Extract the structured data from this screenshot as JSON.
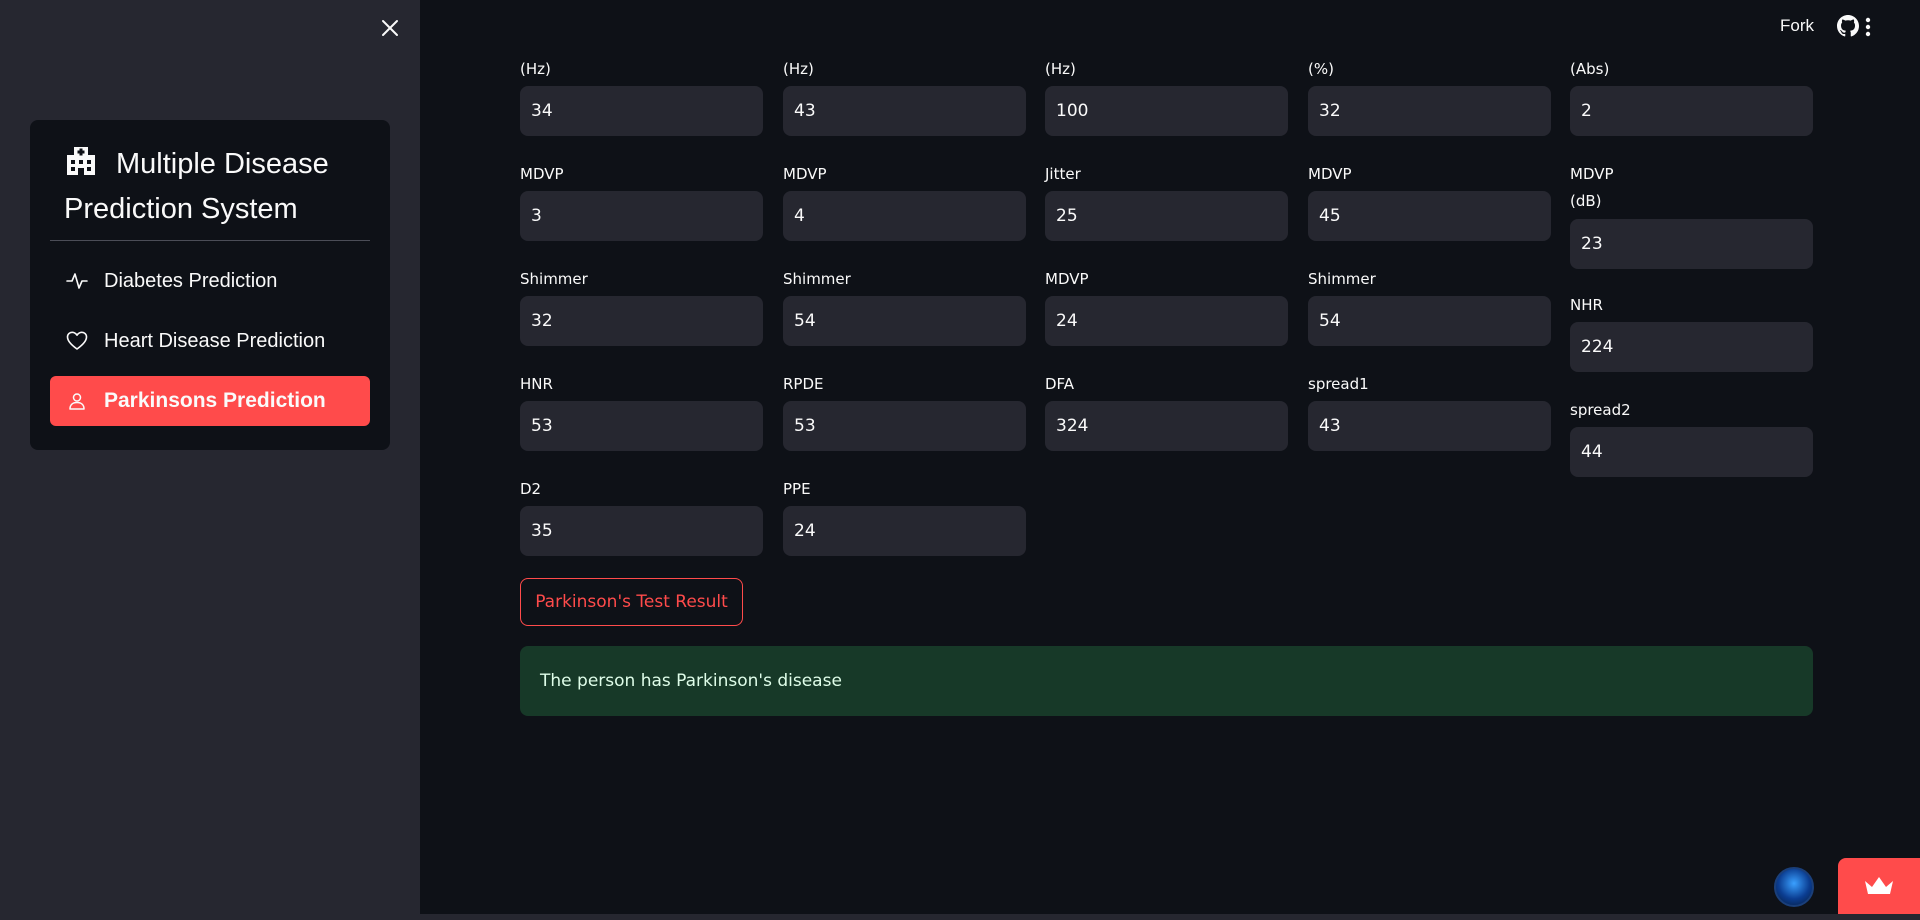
{
  "sidebar": {
    "title": "Multiple Disease Prediction System",
    "items": [
      {
        "label": "Diabetes Prediction",
        "icon": "activity-icon"
      },
      {
        "label": "Heart Disease Prediction",
        "icon": "heart-icon"
      },
      {
        "label": "Parkinsons Prediction",
        "icon": "person-icon"
      }
    ],
    "active_item": "Parkinsons Prediction",
    "accent_color": "#ff4b4b"
  },
  "topbar": {
    "fork_label": "Fork"
  },
  "form": {
    "fields": [
      {
        "label": "(Hz)",
        "value": "34"
      },
      {
        "label": "(Hz)",
        "value": "43"
      },
      {
        "label": "(Hz)",
        "value": "100"
      },
      {
        "label": "(%)",
        "value": "32"
      },
      {
        "label": "(Abs)",
        "value": "2"
      },
      {
        "label": "MDVP",
        "value": "3"
      },
      {
        "label": "MDVP",
        "value": "4"
      },
      {
        "label": "Jitter",
        "value": "25"
      },
      {
        "label": "MDVP",
        "value": "45"
      },
      {
        "label": "MDVP\n(dB)",
        "value": "23"
      },
      {
        "label": "Shimmer",
        "value": "32"
      },
      {
        "label": "Shimmer",
        "value": "54"
      },
      {
        "label": "MDVP",
        "value": "24"
      },
      {
        "label": "Shimmer",
        "value": "54"
      },
      {
        "label": "NHR",
        "value": "224"
      },
      {
        "label": "HNR",
        "value": "53"
      },
      {
        "label": "RPDE",
        "value": "53"
      },
      {
        "label": "DFA",
        "value": "324"
      },
      {
        "label": "spread1",
        "value": "43"
      },
      {
        "label": "spread2",
        "value": "44"
      },
      {
        "label": "D2",
        "value": "35"
      },
      {
        "label": "PPE",
        "value": "24"
      }
    ]
  },
  "result_button_label": "Parkinson's Test Result",
  "result_message": "The person has Parkinson's disease",
  "colors": {
    "background": "#0e1117",
    "sidebar": "#262730",
    "input": "#262730",
    "success_bg": "#173928"
  }
}
